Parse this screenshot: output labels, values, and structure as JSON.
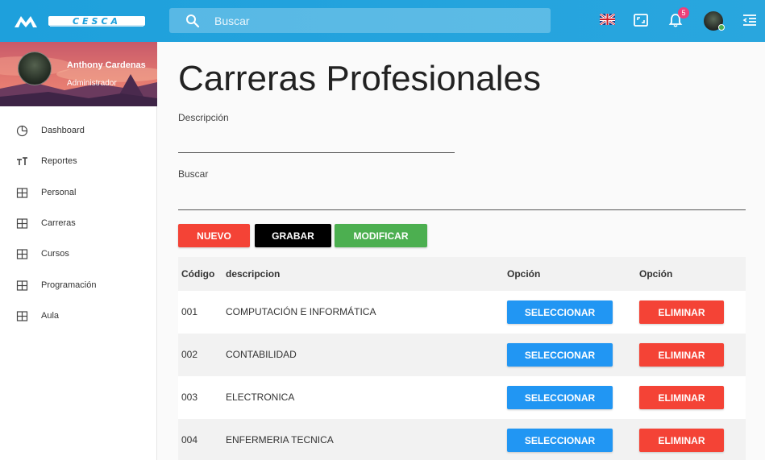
{
  "app": {
    "logo_text": "CESCA",
    "search_placeholder": "Buscar",
    "notifications_count": "5"
  },
  "colors": {
    "topbar": "#1ea0dc",
    "nuevo": "#f44336",
    "grabar": "#000000",
    "modificar": "#4caf50",
    "seleccionar": "#2196f3",
    "eliminar": "#f44336"
  },
  "user": {
    "name": "Anthony Cardenas",
    "role": "Administrador"
  },
  "sidebar": {
    "items": [
      {
        "label": "Dashboard",
        "icon": "pie-chart-icon"
      },
      {
        "label": "Reportes",
        "icon": "text-size-icon"
      },
      {
        "label": "Personal",
        "icon": "grid-icon"
      },
      {
        "label": "Carreras",
        "icon": "grid-icon"
      },
      {
        "label": "Cursos",
        "icon": "grid-icon"
      },
      {
        "label": "Programación",
        "icon": "grid-icon"
      },
      {
        "label": "Aula",
        "icon": "grid-icon"
      }
    ]
  },
  "main": {
    "title": "Carreras Profesionales",
    "descripcion_label": "Descripción",
    "descripcion_value": "",
    "buscar_label": "Buscar",
    "buscar_value": "",
    "buttons": {
      "nuevo": "NUEVO",
      "grabar": "GRABAR",
      "modificar": "MODIFICAR"
    }
  },
  "table": {
    "headers": [
      "Código",
      "descripcion",
      "Opción",
      "Opción"
    ],
    "rows": [
      {
        "codigo": "001",
        "descripcion": "COMPUTACIÓN E INFORMÁTICA",
        "select": "SELECCIONAR",
        "delete": "ELIMINAR"
      },
      {
        "codigo": "002",
        "descripcion": "CONTABILIDAD",
        "select": "SELECCIONAR",
        "delete": "ELIMINAR"
      },
      {
        "codigo": "003",
        "descripcion": "ELECTRONICA",
        "select": "SELECCIONAR",
        "delete": "ELIMINAR"
      },
      {
        "codigo": "004",
        "descripcion": "ENFERMERIA TECNICA",
        "select": "SELECCIONAR",
        "delete": "ELIMINAR"
      }
    ]
  }
}
